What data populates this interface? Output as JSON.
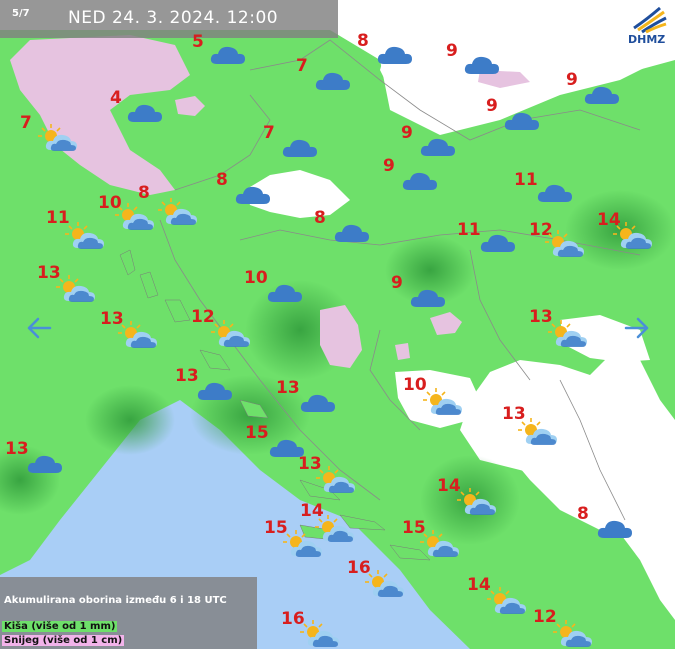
{
  "header": {
    "counter": "5/7",
    "title": "NED 24. 3. 2024. 12:00"
  },
  "logo": {
    "text": "DHMZ"
  },
  "navigation": {
    "prev_icon": "arrow-left-icon",
    "next_icon": "arrow-right-icon"
  },
  "legend": {
    "title": "Akumulirana oborina između 6 i 18 UTC",
    "rain": "Kiša (više od 1 mm)",
    "snow": "Snijeg (više od 1 cm)"
  },
  "colors": {
    "rain": "#6ee06a",
    "rain_dark": "#2f9a3a",
    "snow": "#e6c3e0",
    "sea": "#a9cef6",
    "land": "#ffffff",
    "temperature": "#d81e1e",
    "cloud": "#3d7cc8",
    "sun": "#f5b51c"
  },
  "stations": [
    {
      "temp": "5",
      "icon": "cloud"
    },
    {
      "temp": "8",
      "icon": "cloud"
    },
    {
      "temp": "9",
      "icon": "cloud"
    },
    {
      "temp": "9",
      "icon": "cloud"
    },
    {
      "temp": "7",
      "icon": "cloud"
    },
    {
      "temp": "9",
      "icon": "cloud"
    },
    {
      "temp": "4",
      "icon": "cloud"
    },
    {
      "temp": "7",
      "icon": "partly-cloudy"
    },
    {
      "temp": "7",
      "icon": "cloud"
    },
    {
      "temp": "9",
      "icon": "cloud"
    },
    {
      "temp": "9",
      "icon": "cloud"
    },
    {
      "temp": "8",
      "icon": "cloud"
    },
    {
      "temp": "11",
      "icon": "cloud"
    },
    {
      "temp": "10",
      "icon": "partly-cloudy"
    },
    {
      "temp": "8",
      "icon": "partly-cloudy"
    },
    {
      "temp": "11",
      "icon": "partly-cloudy"
    },
    {
      "temp": "8",
      "icon": "cloud"
    },
    {
      "temp": "11",
      "icon": "cloud"
    },
    {
      "temp": "12",
      "icon": "partly-cloudy"
    },
    {
      "temp": "14",
      "icon": "partly-cloudy"
    },
    {
      "temp": "13",
      "icon": "partly-cloudy"
    },
    {
      "temp": "10",
      "icon": "cloud"
    },
    {
      "temp": "9",
      "icon": "cloud"
    },
    {
      "temp": "13",
      "icon": "partly-cloudy"
    },
    {
      "temp": "12",
      "icon": "partly-cloudy"
    },
    {
      "temp": "13",
      "icon": "partly-cloudy"
    },
    {
      "temp": "13",
      "icon": "cloud"
    },
    {
      "temp": "13",
      "icon": "cloud"
    },
    {
      "temp": "10",
      "icon": "partly-cloudy"
    },
    {
      "temp": "13",
      "icon": "partly-cloudy"
    },
    {
      "temp": "15",
      "icon": "cloud"
    },
    {
      "temp": "13",
      "icon": "cloud"
    },
    {
      "temp": "13",
      "icon": "partly-cloudy"
    },
    {
      "temp": "14",
      "icon": "partly-cloudy"
    },
    {
      "temp": "14",
      "icon": "partly-cloudy"
    },
    {
      "temp": "15",
      "icon": "partly-cloudy"
    },
    {
      "temp": "15",
      "icon": "partly-cloudy"
    },
    {
      "temp": "8",
      "icon": "cloud"
    },
    {
      "temp": "16",
      "icon": "partly-cloudy"
    },
    {
      "temp": "14",
      "icon": "partly-cloudy"
    },
    {
      "temp": "12",
      "icon": "partly-cloudy"
    },
    {
      "temp": "16",
      "icon": "partly-cloudy"
    }
  ]
}
